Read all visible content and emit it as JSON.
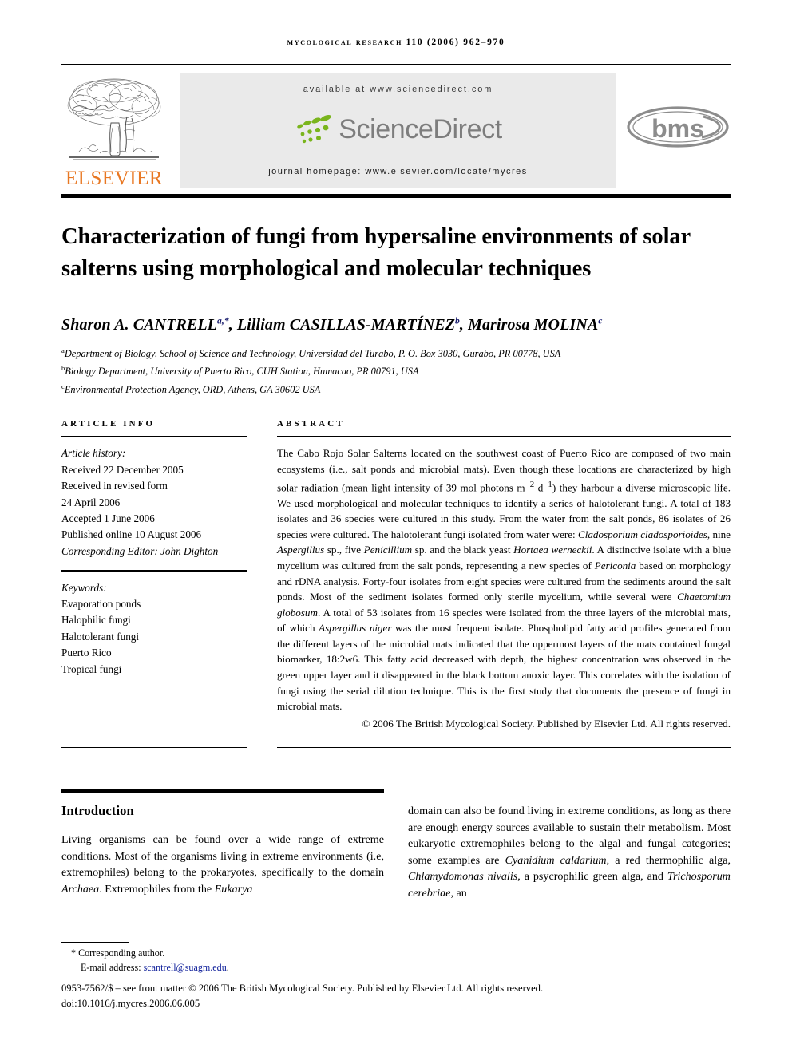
{
  "running_head": "Mycological Research 110 (2006) 962–970",
  "masthead": {
    "publisher_name": "ELSEVIER",
    "available_at": "available at www.sciencedirect.com",
    "sciencedirect_word": "ScienceDirect",
    "journal_homepage": "journal homepage: www.elsevier.com/locate/mycres",
    "society_logo_text": "bms",
    "colors": {
      "elsevier_orange": "#e87722",
      "band_gray": "#eaeaea",
      "sciencedirect_gray": "#7d7d7d",
      "sciencedirect_green": "#7ab51d",
      "bms_gray": "#8c8c8c"
    }
  },
  "article": {
    "title": "Characterization of fungi from hypersaline environments of solar salterns using morphological and molecular techniques",
    "authors_html": "Sharon A. CANTRELL<sup class=\"star\">a,</sup><sup class=\"star\">*</sup>, Lilliam CASILLAS-MARTÍNEZ<sup>b</sup>, Marirosa MOLINA<sup>c</sup>",
    "affiliations": [
      {
        "mark": "a",
        "text": "Department of Biology, School of Science and Technology, Universidad del Turabo, P. O. Box 3030, Gurabo, PR 00778, USA"
      },
      {
        "mark": "b",
        "text": "Biology Department, University of Puerto Rico, CUH Station, Humacao, PR 00791, USA"
      },
      {
        "mark": "c",
        "text": "Environmental Protection Agency, ORD, Athens, GA 30602 USA"
      }
    ]
  },
  "article_info": {
    "heading": "ARTICLE INFO",
    "history_label": "Article history:",
    "history_lines": [
      "Received 22 December 2005",
      "Received in revised form",
      "24 April 2006",
      "Accepted 1 June 2006",
      "Published online 10 August 2006"
    ],
    "corresponding_editor": "Corresponding Editor: John Dighton",
    "keywords_label": "Keywords:",
    "keywords": [
      "Evaporation ponds",
      "Halophilic fungi",
      "Halotolerant fungi",
      "Puerto Rico",
      "Tropical fungi"
    ]
  },
  "abstract": {
    "heading": "ABSTRACT",
    "body_html": "The Cabo Rojo Solar Salterns located on the southwest coast of Puerto Rico are composed of two main ecosystems (i.e., salt ponds and microbial mats). Even though these locations are characterized by high solar radiation (mean light intensity of 39 mol photons m<sup>&minus;2</sup> d<sup>&minus;1</sup>) they harbour a diverse microscopic life. We used morphological and molecular techniques to identify a series of halotolerant fungi. A total of 183 isolates and 36 species were cultured in this study. From the water from the salt ponds, 86 isolates of 26 species were cultured. The halotolerant fungi isolated from water were: <i>Cladosporium cladosporioides</i>, nine <i>Aspergillus</i> sp., five <i>Penicillium</i> sp. and the black yeast <i>Hortaea werneckii</i>. A distinctive isolate with a blue mycelium was cultured from the salt ponds, representing a new species of <i>Periconia</i> based on morphology and rDNA analysis. Forty-four isolates from eight species were cultured from the sediments around the salt ponds. Most of the sediment isolates formed only sterile mycelium, while several were <i>Chaetomium globosum</i>. A total of 53 isolates from 16 species were isolated from the three layers of the microbial mats, of which <i>Aspergillus niger</i> was the most frequent isolate. Phospholipid fatty acid profiles generated from the different layers of the microbial mats indicated that the uppermost layers of the mats contained fungal biomarker, 18:2w6. This fatty acid decreased with depth, the highest concentration was observed in the green upper layer and it disappeared in the black bottom anoxic layer. This correlates with the isolation of fungi using the serial dilution technique. This is the first study that documents the presence of fungi in microbial mats.",
    "copyright": "© 2006 The British Mycological Society. Published by Elsevier Ltd. All rights reserved."
  },
  "body": {
    "section_heading": "Introduction",
    "left_paragraph_html": "Living organisms can be found over a wide range of extreme conditions. Most of the organisms living in extreme environments (i.e, extremophiles) belong to the prokaryotes, specifically to the domain <i>Archaea</i>. Extremophiles from the <i>Eukarya</i>",
    "right_paragraph_html": "domain can also be found living in extreme conditions, as long as there are enough energy sources available to sustain their metabolism. Most eukaryotic extremophiles belong to the algal and fungal categories; some examples are <i>Cyanidium caldarium</i>, a red thermophilic alga, <i>Chlamydomonas nivalis</i>, a psycrophilic green alga, and <i>Trichosporum cerebriae</i>, an"
  },
  "footer": {
    "corresponding_author": "* Corresponding author.",
    "email_label": "E-mail address:",
    "email": "scantrell@suagm.edu",
    "email_trailing": ".",
    "front_matter": "0953-7562/$ – see front matter © 2006 The British Mycological Society. Published by Elsevier Ltd. All rights reserved.",
    "doi": "doi:10.1016/j.mycres.2006.06.005"
  }
}
